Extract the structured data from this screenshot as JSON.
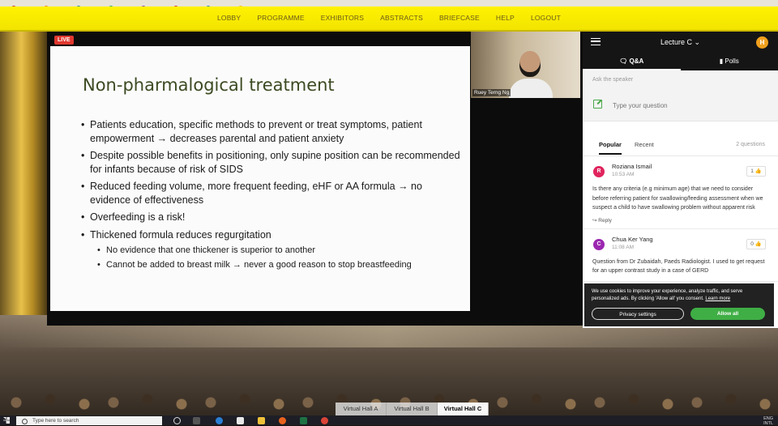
{
  "nav": {
    "items": [
      "LOBBY",
      "PROGRAMME",
      "EXHIBITORS",
      "ABSTRACTS",
      "BRIEFCASE",
      "HELP",
      "LOGOUT"
    ]
  },
  "stream": {
    "live_label": "LIVE",
    "speaker_name": "Ruey Terng Ng"
  },
  "slide": {
    "title": "Non-pharmalogical treatment",
    "bullets": [
      "Patients education, specific methods to prevent or treat symptoms, patient empowerment → decreases parental and patient anxiety",
      "Despite possible benefits in positioning, only supine position can be recommended for infants because of risk of SIDS",
      "Reduced feeding volume, more frequent feeding, eHF or AA formula → no evidence of effectiveness",
      "Overfeeding is a risk!",
      "Thickened formula reduces regurgitation"
    ],
    "sub_bullets": [
      "No evidence that one thickener is superior to another",
      "Cannot be added to breast milk → never a good reason to stop breastfeeding"
    ]
  },
  "panel": {
    "title": "Lecture C",
    "avatar_initial": "H",
    "tabs": [
      "Q&A",
      "Polls"
    ],
    "ask_label": "Ask the speaker",
    "ask_placeholder": "Type your question",
    "sort_tabs": [
      "Popular",
      "Recent"
    ],
    "question_count": "2 questions",
    "questions": [
      {
        "initial": "R",
        "avatar_color": "#e0245e",
        "name": "Roziana Ismail",
        "time": "10:53 AM",
        "likes": "1",
        "text": "Is there any criteria (e.g minimum age) that we need to consider before referring patient for swallowing/feeding assessment when we suspect a child to have swallowing problem without apparent risk",
        "reply_label": "Reply"
      },
      {
        "initial": "C",
        "avatar_color": "#9b27b0",
        "name": "Chua Ker Yang",
        "time": "11:08 AM",
        "likes": "0",
        "text": "Question from Dr Zubaidah, Paeds Radiologist. I used to get request for an upper contrast study in a case of GERD"
      }
    ]
  },
  "cookie": {
    "text": "We use cookies to improve your experience, analyze traffic, and serve personalized ads. By clicking 'Allow all' you consent.",
    "learn_more": "Learn more",
    "settings_label": "Privacy settings",
    "allow_label": "Allow all"
  },
  "halls": [
    "Virtual Hall A",
    "Virtual Hall B",
    "Virtual Hall C"
  ],
  "taskbar": {
    "search_placeholder": "Type here to search",
    "lang": "ENG",
    "region": "INTL"
  },
  "colors": {
    "nav_yellow": "#fff200",
    "live_red": "#e0382f",
    "accent_green": "#3fae45"
  }
}
